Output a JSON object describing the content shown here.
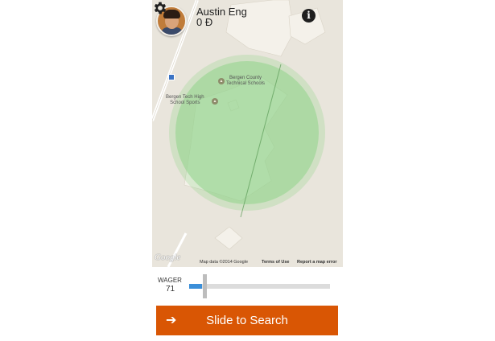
{
  "user": {
    "name": "Austin Eng",
    "balance": "0 Đ"
  },
  "header_icons": {
    "info": "info-icon",
    "settings": "gear-icon"
  },
  "map": {
    "pois": [
      {
        "label_line1": "Bergen County",
        "label_line2": "Technical Schools",
        "icon": "school-icon"
      },
      {
        "label_line1": "Bergen Tech High",
        "label_line2": "School Sports",
        "icon": "school-icon"
      }
    ],
    "logo": "Google",
    "attribution": {
      "map_data": "Map data ©2014 Google",
      "terms": "Terms of Use",
      "report": "Report a map error"
    },
    "colors": {
      "land": "#e9e5dc",
      "building": "#f4f1ea",
      "search_radius": "#8fd48a"
    }
  },
  "wager": {
    "label": "WAGER",
    "value": "71",
    "fraction": 0.09
  },
  "search_button": {
    "label": "Slide to Search",
    "icon": "arrow-right-icon",
    "color": "#d95604"
  }
}
